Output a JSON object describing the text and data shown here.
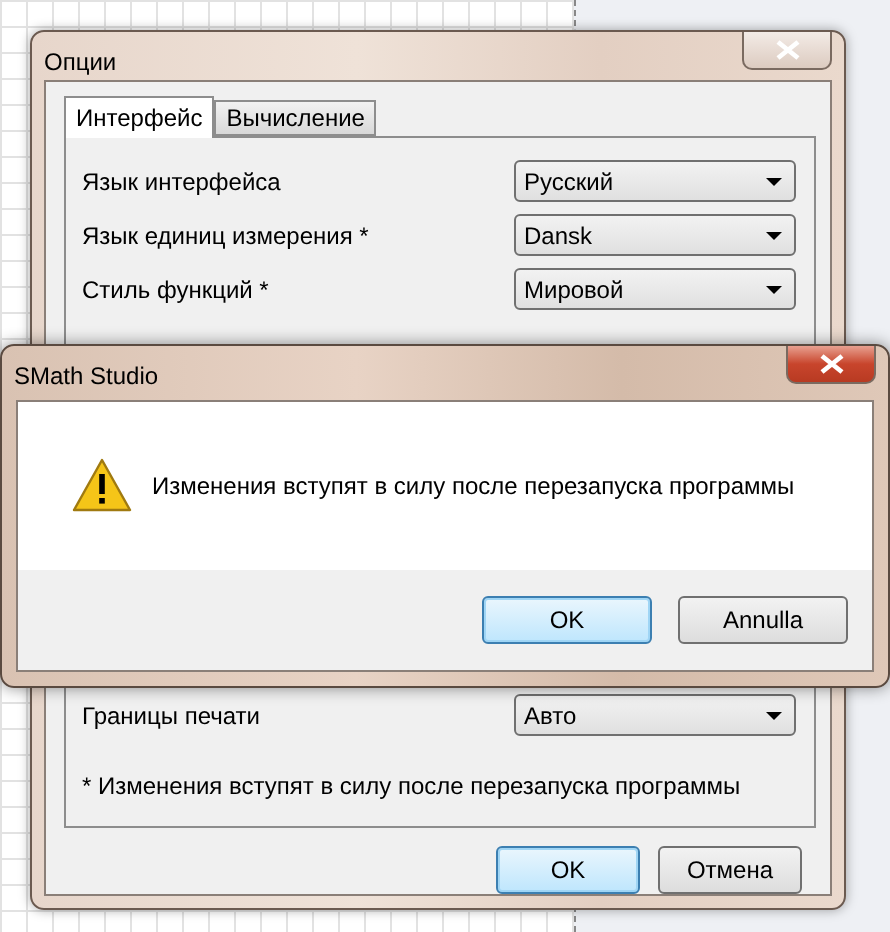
{
  "options_window": {
    "title": "Опции",
    "tabs": [
      {
        "label": "Интерфейс",
        "selected": true
      },
      {
        "label": "Вычисление",
        "selected": false
      }
    ],
    "rows": [
      {
        "label": "Язык интерфейса",
        "value": "Русский"
      },
      {
        "label": "Язык единиц измерения *",
        "value": "Dansk"
      },
      {
        "label": "Стиль функций *",
        "value": "Мировой"
      }
    ],
    "lower_rows": [
      {
        "label": "Границы печати",
        "value": "Авто"
      }
    ],
    "footnote": "* Изменения вступят в силу после перезапуска программы",
    "buttons": [
      {
        "label": "OK",
        "default": true
      },
      {
        "label": "Отмена",
        "default": false
      }
    ]
  },
  "message_box": {
    "title": "SMath Studio",
    "message": "Изменения вступят в силу после перезапуска программы",
    "buttons": [
      {
        "label": "OK",
        "default": true
      },
      {
        "label": "Annulla",
        "default": false
      }
    ]
  }
}
